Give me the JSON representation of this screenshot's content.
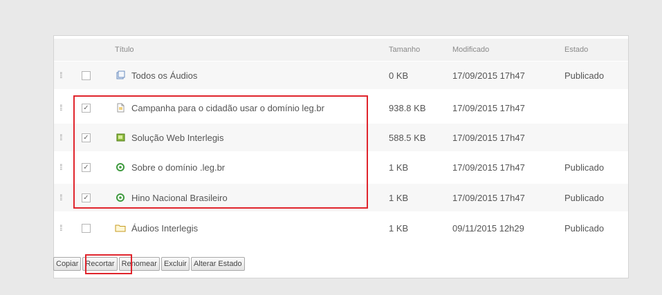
{
  "table": {
    "headers": {
      "title": "Título",
      "size": "Tamanho",
      "modified": "Modificado",
      "state": "Estado"
    },
    "rows": [
      {
        "title": "Todos os Áudios",
        "size": "0 KB",
        "modified": "17/09/2015 17h47",
        "state": "Publicado",
        "checked": false,
        "icon": "folder-link-icon"
      },
      {
        "title": "Campanha para o cidadão usar o domínio leg.br",
        "size": "938.8 KB",
        "modified": "17/09/2015 17h47",
        "state": "",
        "checked": true,
        "icon": "document-icon"
      },
      {
        "title": "Solução Web Interlegis",
        "size": "588.5 KB",
        "modified": "17/09/2015 17h47",
        "state": "",
        "checked": true,
        "icon": "audio-file-icon"
      },
      {
        "title": "Sobre o domínio .leg.br",
        "size": "1 KB",
        "modified": "17/09/2015 17h47",
        "state": "Publicado",
        "checked": true,
        "icon": "link-icon"
      },
      {
        "title": "Hino Nacional Brasileiro",
        "size": "1 KB",
        "modified": "17/09/2015 17h47",
        "state": "Publicado",
        "checked": true,
        "icon": "link-icon"
      },
      {
        "title": "Áudios Interlegis",
        "size": "1 KB",
        "modified": "09/11/2015 12h29",
        "state": "Publicado",
        "checked": false,
        "icon": "folder-icon"
      }
    ]
  },
  "buttons": {
    "copy": "Copiar",
    "cut": "Recortar",
    "rename": "Renomear",
    "delete": "Excluir",
    "change_state": "Alterar Estado"
  },
  "colors": {
    "highlight": "#e0242c",
    "panel_bg": "#ffffff",
    "page_bg": "#e9e9e9"
  }
}
